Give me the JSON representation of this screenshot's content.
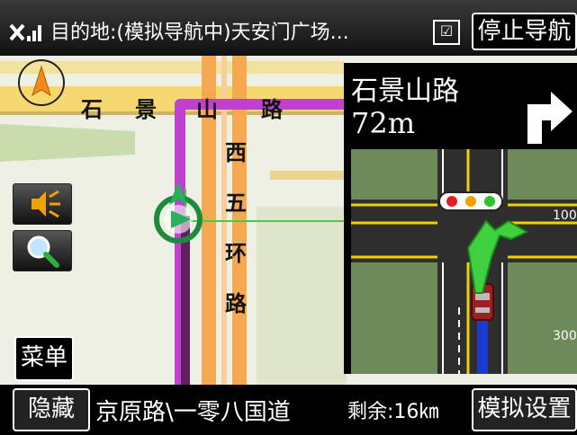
{
  "status_bar": {
    "destination_text": "目的地:(模拟导航中)天安门广场...",
    "dropdown_symbol": "☑",
    "stop_button_label": "停止导航"
  },
  "map": {
    "road_horizontal_chars": [
      "石",
      "景",
      "山",
      "路"
    ],
    "road_vertical_chars": [
      "西",
      "五",
      "环",
      "路"
    ]
  },
  "guidance": {
    "next_road": "石景山路",
    "distance": "72m",
    "scale_labels": [
      "100",
      "300"
    ]
  },
  "side_buttons": {
    "menu_label": "菜单"
  },
  "bottom_bar": {
    "hide_label": "隐藏",
    "current_road": "京原路\\一零八国道",
    "remaining": "剩余:16㎞",
    "sim_settings_label": "模拟设置"
  },
  "colors": {
    "route": "#c040d0",
    "road_orange": "#f4a850",
    "road_yellow": "#f5d870",
    "grass": "#6e8a5a",
    "position_ring": "#1d8a3c"
  }
}
